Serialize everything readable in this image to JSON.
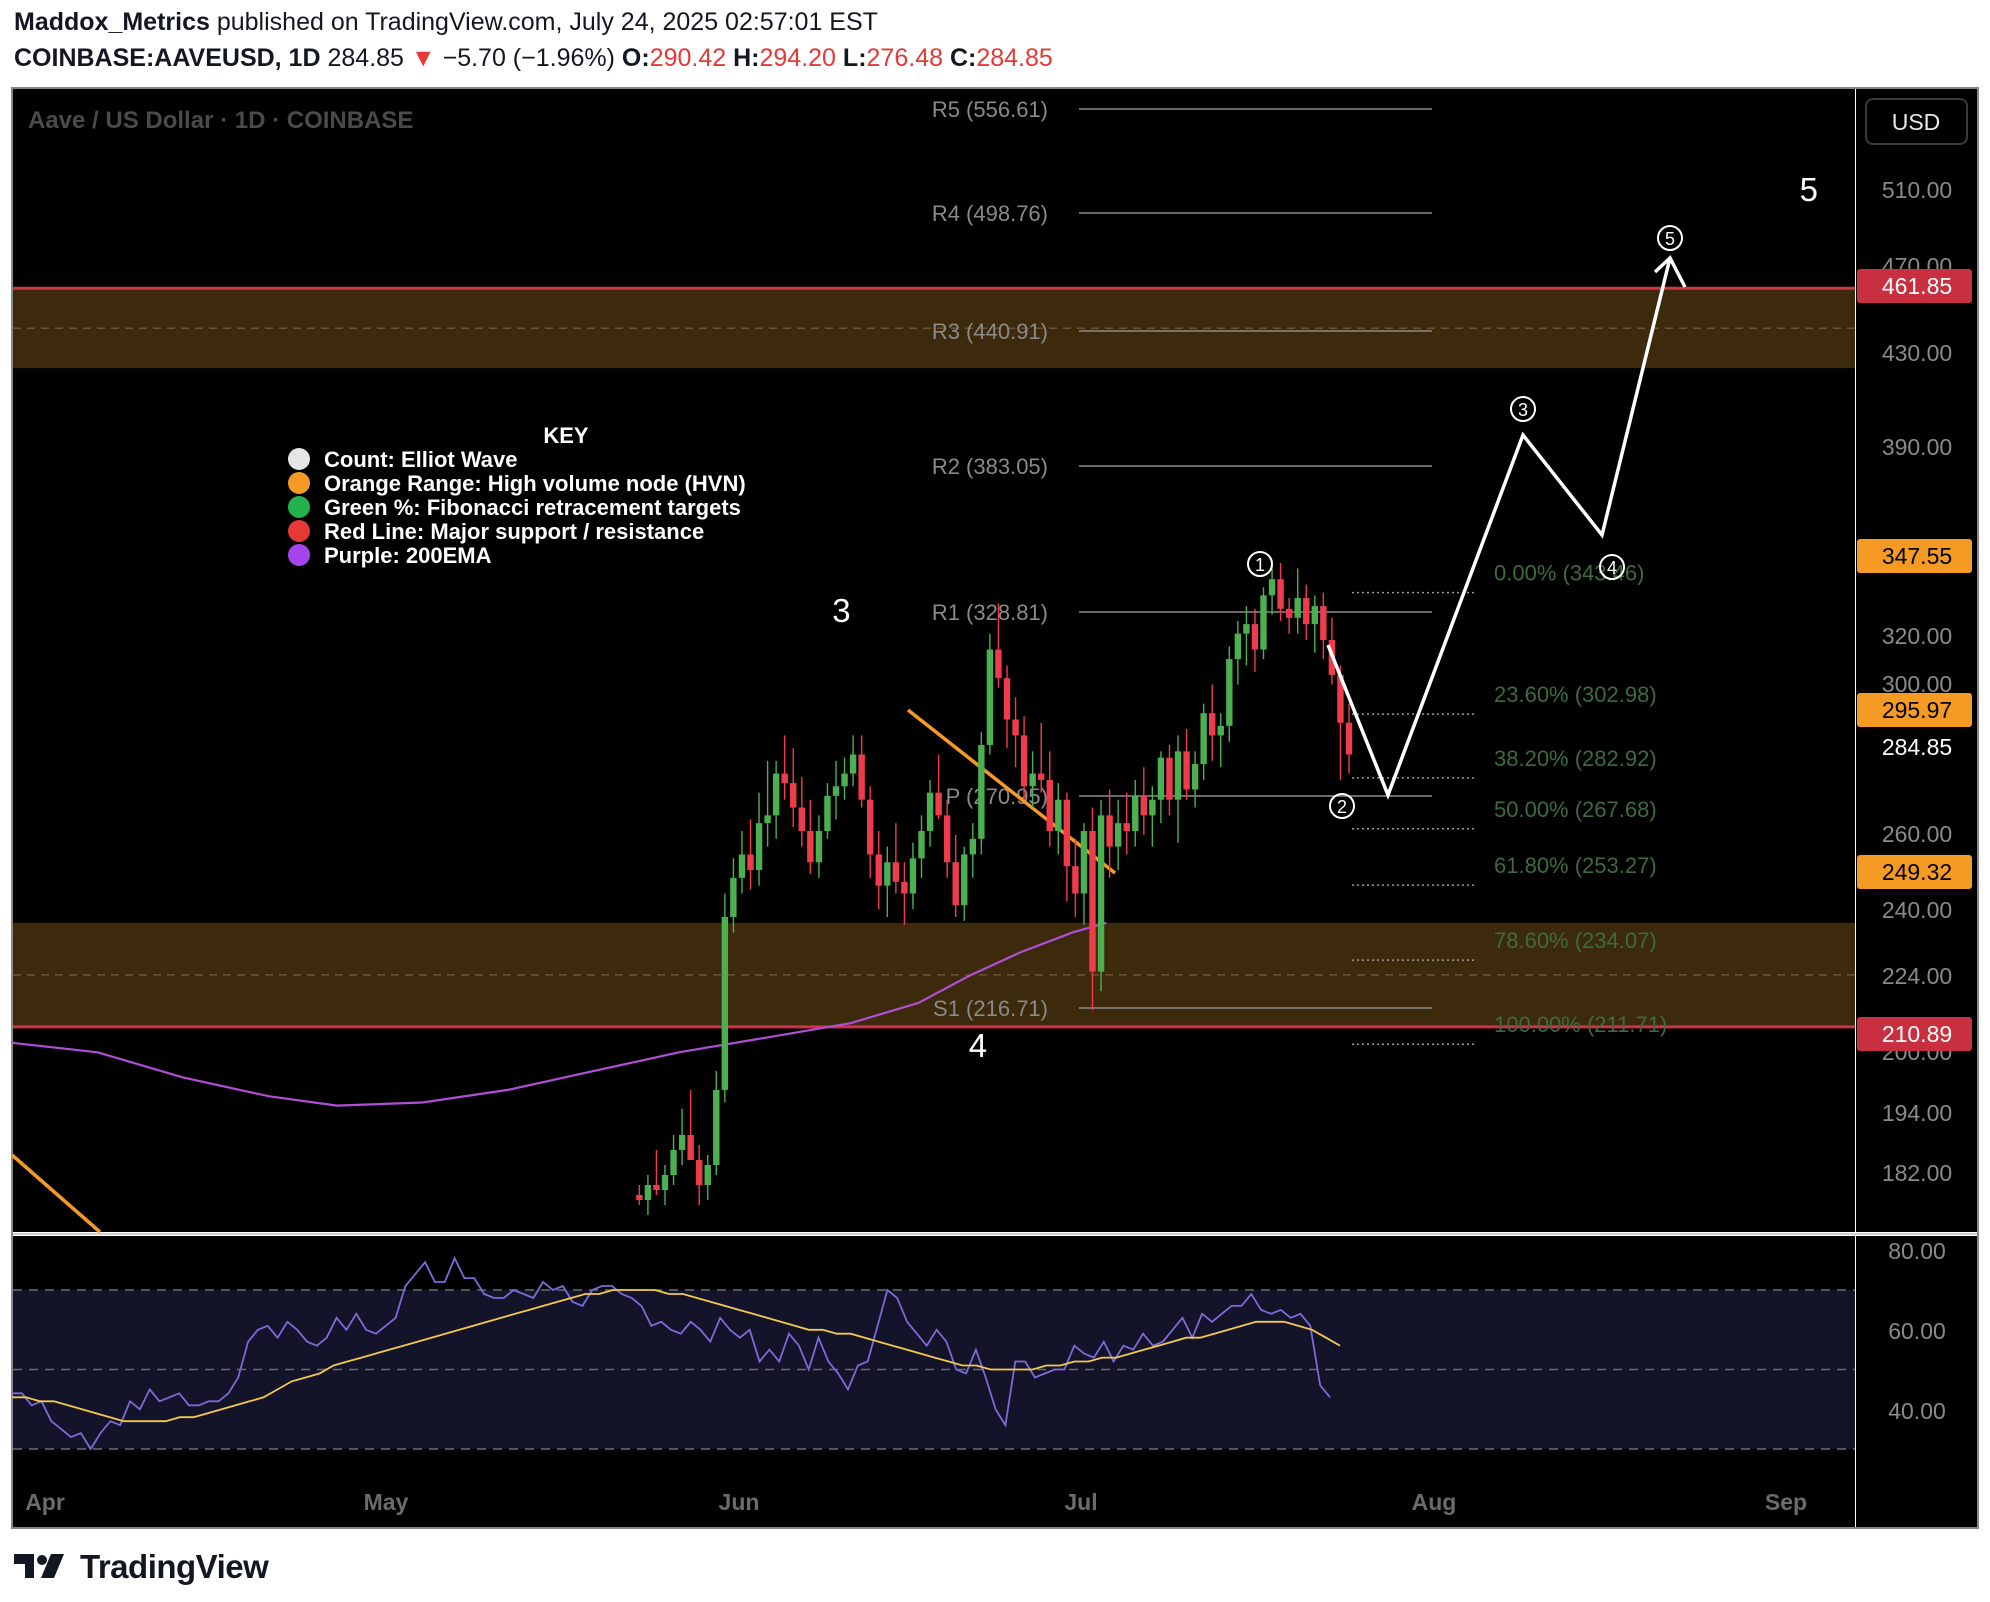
{
  "header": {
    "author": "Maddox_Metrics",
    "published_text": "published on TradingView.com, July 24, 2025 02:57:01 EST",
    "symbol": "COINBASE:AAVEUSD, 1D",
    "last": "284.85",
    "arrow": "▼",
    "change": "−5.70 (−1.96%)",
    "o_label": "O:",
    "o_value": "290.42",
    "h_label": "H:",
    "h_value": "294.20",
    "l_label": "L:",
    "l_value": "276.48",
    "c_label": "C:",
    "c_value": "284.85"
  },
  "chart_title": "Aave / US Dollar · 1D · COINBASE",
  "currency_button": "USD",
  "footer_brand": "TradingView",
  "key": {
    "title": "KEY",
    "items": [
      {
        "color": "#e6e6e6",
        "text": "Count: Elliot Wave"
      },
      {
        "color": "#f59a23",
        "text": "Orange Range: High volume node (HVN)"
      },
      {
        "color": "#22b14c",
        "text": "Green %: Fibonacci retracement targets"
      },
      {
        "color": "#e53935",
        "text": "Red Line: Major support / resistance"
      },
      {
        "color": "#a545f0",
        "text": "Purple: 200EMA"
      }
    ]
  },
  "colors": {
    "background": "#000000",
    "bull": "#26a69a",
    "bull_candle": "#4caf50",
    "bear_candle": "#ef3c4d",
    "hvn_zone": "#3d2a0c",
    "support_line": "#d03347",
    "ema": "#b04fd6",
    "rsi": "#7c6bd6",
    "rsi_ma": "#f2c94c",
    "fib_text": "#3d6b3d",
    "pivot_text": "#8a8a8a"
  },
  "chart_data": {
    "type": "candlestick",
    "symbol": "COINBASE:AAVEUSD",
    "interval": "1D",
    "y_axis_ticks": [
      "510.00",
      "470.00",
      "430.00",
      "390.00",
      "320.00",
      "300.00",
      "280.00",
      "260.00",
      "240.00",
      "224.00",
      "194.00",
      "182.00",
      "200.00"
    ],
    "x_axis_ticks": [
      "Apr",
      "May",
      "Jun",
      "Jul",
      "Aug",
      "Sep"
    ],
    "price_tags": [
      {
        "value": "461.85",
        "kind": "red"
      },
      {
        "value": "347.55",
        "kind": "orange"
      },
      {
        "value": "295.97",
        "kind": "orange"
      },
      {
        "value": "284.85",
        "kind": "last"
      },
      {
        "value": "249.32",
        "kind": "orange"
      },
      {
        "value": "210.89",
        "kind": "red"
      }
    ],
    "pivots": [
      {
        "label": "R5 (556.61)",
        "value": 556.61
      },
      {
        "label": "R4 (498.76)",
        "value": 498.76
      },
      {
        "label": "R3 (440.91)",
        "value": 440.91
      },
      {
        "label": "R2 (383.05)",
        "value": 383.05
      },
      {
        "label": "R1 (328.81)",
        "value": 328.81
      },
      {
        "label": "P (270.95)",
        "value": 270.95
      },
      {
        "label": "S1 (216.71)",
        "value": 216.71
      }
    ],
    "fib_levels": [
      {
        "label": "0.00% (343.46)",
        "value": 343.46
      },
      {
        "label": "23.60% (302.98)",
        "value": 302.98
      },
      {
        "label": "38.20% (282.92)",
        "value": 282.92
      },
      {
        "label": "50.00% (267.68)",
        "value": 267.68
      },
      {
        "label": "61.80% (253.27)",
        "value": 253.27
      },
      {
        "label": "78.60% (234.07)",
        "value": 234.07
      },
      {
        "label": "100.00% (211.71)",
        "value": 211.71
      }
    ],
    "hvn_zones": [
      [
        425,
        461.85
      ],
      [
        210.89,
        238.5
      ]
    ],
    "support_resistance": [
      461.85,
      210.89
    ],
    "wave_labels": [
      {
        "text": "3",
        "date": "Jun 10",
        "price": 336
      },
      {
        "text": "4",
        "date": "Jun 22",
        "price": 205
      },
      {
        "text": "5",
        "date": "Sep 3",
        "price": 530
      }
    ],
    "sub_wave_labels": [
      "1",
      "2",
      "3",
      "4",
      "5"
    ],
    "projection_path": [
      {
        "date": "Jul 22",
        "price": 308
      },
      {
        "date": "Jul 27",
        "price": 272
      },
      {
        "date": "Aug 11",
        "price": 395
      },
      {
        "date": "Aug 23",
        "price": 350
      },
      {
        "date": "Sep 3",
        "price": 475
      }
    ],
    "candles_ohlc": [
      [
        178,
        180,
        176,
        177
      ],
      [
        177,
        182,
        174,
        180
      ],
      [
        180,
        187,
        178,
        179
      ],
      [
        179,
        184,
        176,
        182
      ],
      [
        182,
        190,
        180,
        187
      ],
      [
        187,
        195,
        184,
        190
      ],
      [
        190,
        198,
        186,
        185
      ],
      [
        185,
        188,
        176,
        180
      ],
      [
        180,
        186,
        177,
        184
      ],
      [
        184,
        201,
        182,
        198
      ],
      [
        198,
        246,
        196,
        240
      ],
      [
        240,
        255,
        236,
        250
      ],
      [
        250,
        262,
        246,
        256
      ],
      [
        256,
        265,
        247,
        252
      ],
      [
        252,
        272,
        248,
        264
      ],
      [
        264,
        282,
        258,
        266
      ],
      [
        266,
        282,
        260,
        278
      ],
      [
        278,
        290,
        270,
        275
      ],
      [
        275,
        286,
        263,
        268
      ],
      [
        268,
        277,
        258,
        262
      ],
      [
        262,
        270,
        251,
        254
      ],
      [
        254,
        266,
        250,
        262
      ],
      [
        262,
        275,
        260,
        271
      ],
      [
        271,
        282,
        265,
        274
      ],
      [
        274,
        283,
        270,
        278
      ],
      [
        278,
        290,
        274,
        284
      ],
      [
        284,
        290,
        268,
        270
      ],
      [
        270,
        274,
        250,
        256
      ],
      [
        256,
        262,
        242,
        248
      ],
      [
        248,
        258,
        240,
        254
      ],
      [
        254,
        264,
        246,
        249
      ],
      [
        249,
        254,
        238,
        246
      ],
      [
        246,
        259,
        242,
        255
      ],
      [
        255,
        266,
        250,
        262
      ],
      [
        262,
        276,
        258,
        272
      ],
      [
        272,
        284,
        265,
        266
      ],
      [
        266,
        270,
        250,
        254
      ],
      [
        254,
        261,
        240,
        243
      ],
      [
        243,
        258,
        239,
        256
      ],
      [
        256,
        264,
        250,
        260
      ],
      [
        260,
        291,
        256,
        287
      ],
      [
        287,
        322,
        284,
        317
      ],
      [
        317,
        332,
        305,
        308
      ],
      [
        308,
        312,
        286,
        295
      ],
      [
        295,
        302,
        280,
        290
      ],
      [
        290,
        296,
        270,
        274
      ],
      [
        274,
        285,
        268,
        278
      ],
      [
        278,
        294,
        272,
        276
      ],
      [
        276,
        285,
        258,
        262
      ],
      [
        262,
        275,
        256,
        270
      ],
      [
        270,
        272,
        244,
        253
      ],
      [
        253,
        260,
        240,
        246
      ],
      [
        246,
        264,
        238,
        262
      ],
      [
        262,
        268,
        216,
        226
      ],
      [
        226,
        270,
        221,
        266
      ],
      [
        266,
        273,
        250,
        258
      ],
      [
        258,
        270,
        252,
        264
      ],
      [
        264,
        272,
        256,
        262
      ],
      [
        262,
        276,
        258,
        271
      ],
      [
        271,
        280,
        261,
        266
      ],
      [
        266,
        274,
        258,
        270
      ],
      [
        270,
        285,
        264,
        283
      ],
      [
        283,
        287,
        266,
        270
      ],
      [
        270,
        290,
        259,
        285
      ],
      [
        285,
        292,
        270,
        273
      ],
      [
        273,
        285,
        268,
        281
      ],
      [
        281,
        300,
        276,
        297
      ],
      [
        297,
        306,
        282,
        290
      ],
      [
        290,
        297,
        280,
        293
      ],
      [
        293,
        318,
        288,
        314
      ],
      [
        314,
        326,
        306,
        322
      ],
      [
        322,
        331,
        312,
        325
      ],
      [
        325,
        330,
        310,
        317
      ],
      [
        317,
        338,
        314,
        335
      ],
      [
        335,
        346,
        328,
        341
      ],
      [
        341,
        347,
        326,
        330
      ],
      [
        330,
        334,
        322,
        327
      ],
      [
        327,
        345,
        322,
        334
      ],
      [
        334,
        339,
        320,
        325
      ],
      [
        325,
        335,
        316,
        331
      ],
      [
        331,
        336,
        314,
        320
      ],
      [
        320,
        327,
        306,
        309
      ],
      [
        309,
        312,
        276,
        294
      ],
      [
        294,
        300,
        278,
        284
      ]
    ],
    "ema200_note": "200EMA rising from ~195 (May) to ~238 (late Jul)",
    "rsi": {
      "ticks": [
        "80.00",
        "60.00",
        "40.00"
      ],
      "bands": [
        70,
        50,
        30
      ],
      "range": [
        25,
        85
      ],
      "values": [
        44,
        44,
        41,
        42,
        37,
        35,
        33,
        34,
        30,
        34,
        37,
        36,
        42,
        40,
        45,
        42,
        43,
        44,
        41,
        41,
        42,
        42,
        44,
        48,
        57,
        60,
        61,
        58,
        62,
        60,
        57,
        56,
        58,
        63,
        60,
        64,
        60,
        59,
        61,
        63,
        71,
        74,
        77,
        72,
        72,
        78,
        73,
        73,
        69,
        68,
        68,
        70,
        69,
        68,
        72,
        70,
        71,
        67,
        66,
        70,
        71,
        71,
        69,
        68,
        66,
        61,
        62,
        60,
        59,
        62,
        60,
        57,
        63,
        60,
        58,
        60,
        52,
        55,
        52,
        59,
        56,
        50,
        58,
        52,
        49,
        45,
        51,
        52,
        61,
        70,
        68,
        62,
        59,
        56,
        60,
        57,
        50,
        49,
        55,
        48,
        40,
        36,
        52,
        52,
        48,
        49,
        50,
        50,
        56,
        54,
        53,
        57,
        52,
        56,
        55,
        59,
        56,
        57,
        60,
        63,
        58,
        64,
        62,
        64,
        66,
        66,
        69,
        65,
        64,
        65,
        63,
        64,
        61,
        46,
        43
      ],
      "ma": [
        43,
        43,
        42,
        42,
        41,
        40,
        39,
        38,
        37,
        37,
        37,
        37,
        38,
        38,
        39,
        40,
        41,
        42,
        43,
        45,
        47,
        48,
        49,
        51,
        52,
        53,
        54,
        55,
        56,
        57,
        58,
        59,
        60,
        61,
        62,
        63,
        64,
        65,
        66,
        67,
        68,
        69,
        69,
        70,
        70,
        70,
        70,
        69,
        69,
        68,
        67,
        66,
        65,
        64,
        63,
        62,
        61,
        60,
        60,
        59,
        59,
        58,
        57,
        56,
        55,
        54,
        53,
        52,
        51,
        51,
        50,
        50,
        50,
        50,
        51,
        51,
        52,
        52,
        53,
        53,
        54,
        55,
        56,
        57,
        58,
        58,
        59,
        60,
        61,
        62,
        62,
        62,
        61,
        60,
        58,
        56
      ]
    }
  }
}
